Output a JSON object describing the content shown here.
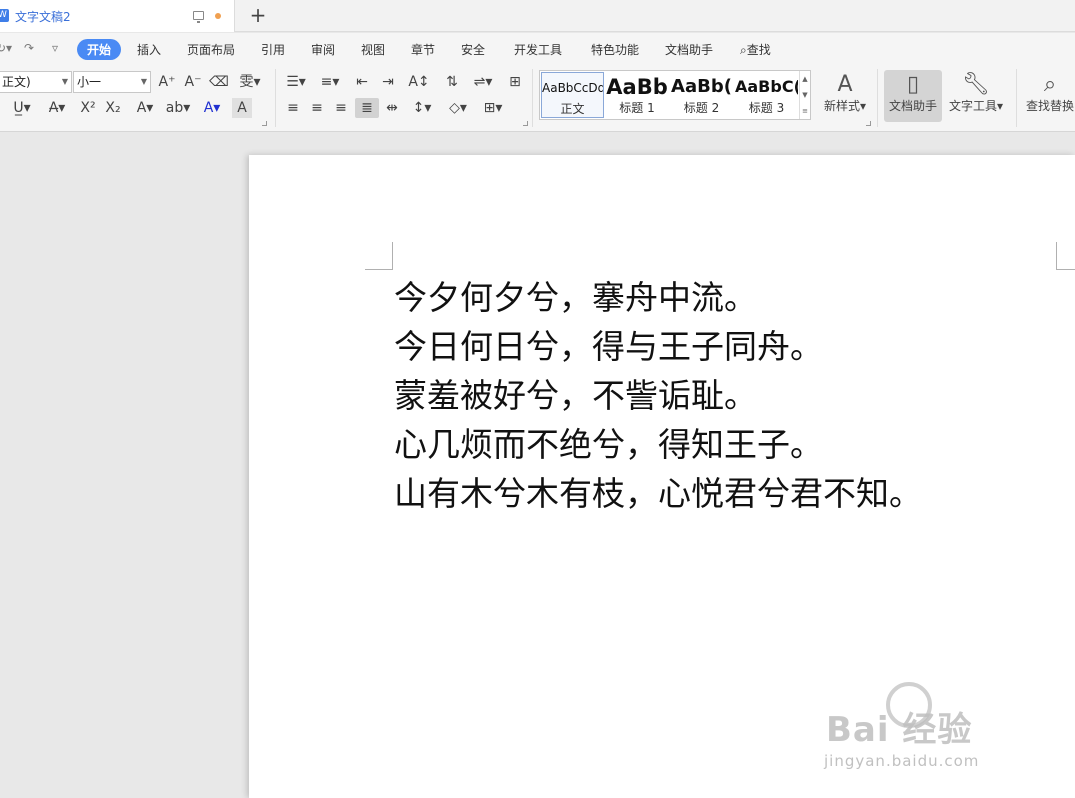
{
  "tab": {
    "title": "文字文稿2",
    "new_tab": "+"
  },
  "menu": {
    "items": [
      "开始",
      "插入",
      "页面布局",
      "引用",
      "审阅",
      "视图",
      "章节",
      "安全",
      "开发工具",
      "特色功能",
      "文档助手"
    ],
    "search": "查找"
  },
  "ribbon": {
    "font_name": "正文)",
    "font_size": "小一",
    "styles": [
      {
        "sample": "AaBbCcDd",
        "name": "正文"
      },
      {
        "sample": "AaBb",
        "name": "标题 1"
      },
      {
        "sample": "AaBb(",
        "name": "标题 2"
      },
      {
        "sample": "AaBbC(",
        "name": "标题 3"
      }
    ],
    "new_style": "新样式",
    "doc_assistant": "文档助手",
    "text_tools": "文字工具",
    "find_replace": "查找替换"
  },
  "document": {
    "lines": [
      "今夕何夕兮，搴舟中流。",
      "今日何日兮，得与王子同舟。",
      "蒙羞被好兮，不訾诟耻。",
      "心几烦而不绝兮，得知王子。",
      "山有木兮木有枝，心悦君兮君不知。"
    ]
  },
  "watermark": {
    "logo": "Bai  经验",
    "url": "jingyan.baidu.com"
  },
  "colors": {
    "accent": "#4a8af4",
    "tab_title": "#3a6fd8",
    "unsaved_dot": "#f0a050"
  }
}
